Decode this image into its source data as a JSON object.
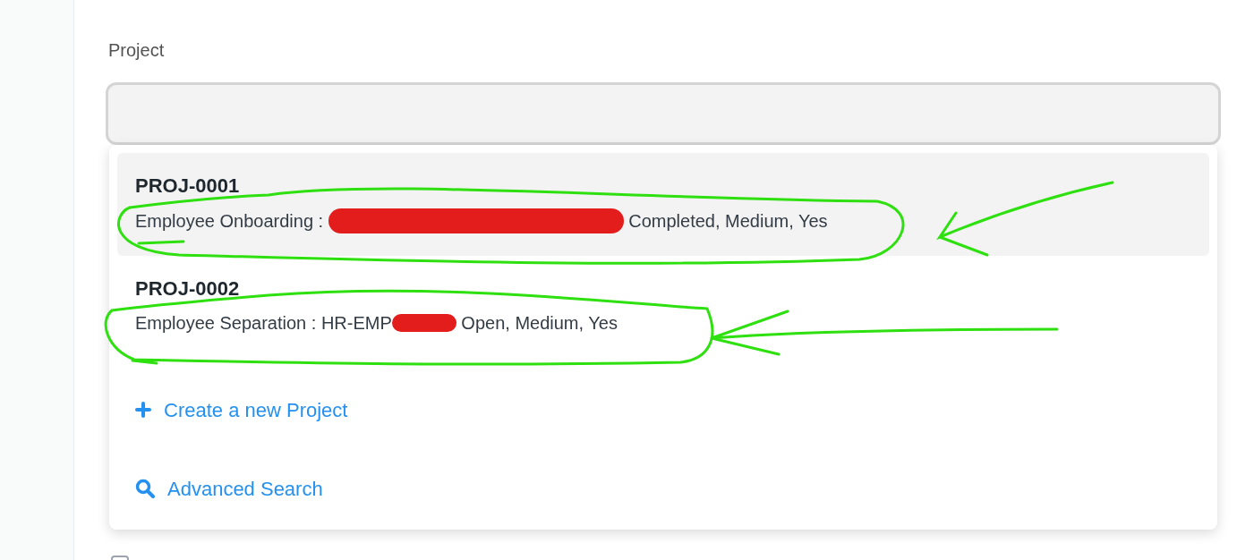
{
  "field": {
    "label": "Project"
  },
  "dropdown": {
    "items": [
      {
        "title": "PROJ-0001",
        "description_start": "Employee Onboarding : ",
        "redacted": true,
        "description_end": " Completed, Medium, Yes",
        "selected": true
      },
      {
        "title": "PROJ-0002",
        "description_start": "Employee Separation : HR-EMP",
        "redacted": true,
        "description_end": " Open, Medium, Yes",
        "selected": false
      }
    ],
    "actions": [
      {
        "kind": "create",
        "label": "Create a new Project"
      },
      {
        "kind": "search",
        "label": "Advanced Search"
      }
    ]
  },
  "checkbox": {
    "checked": false
  }
}
